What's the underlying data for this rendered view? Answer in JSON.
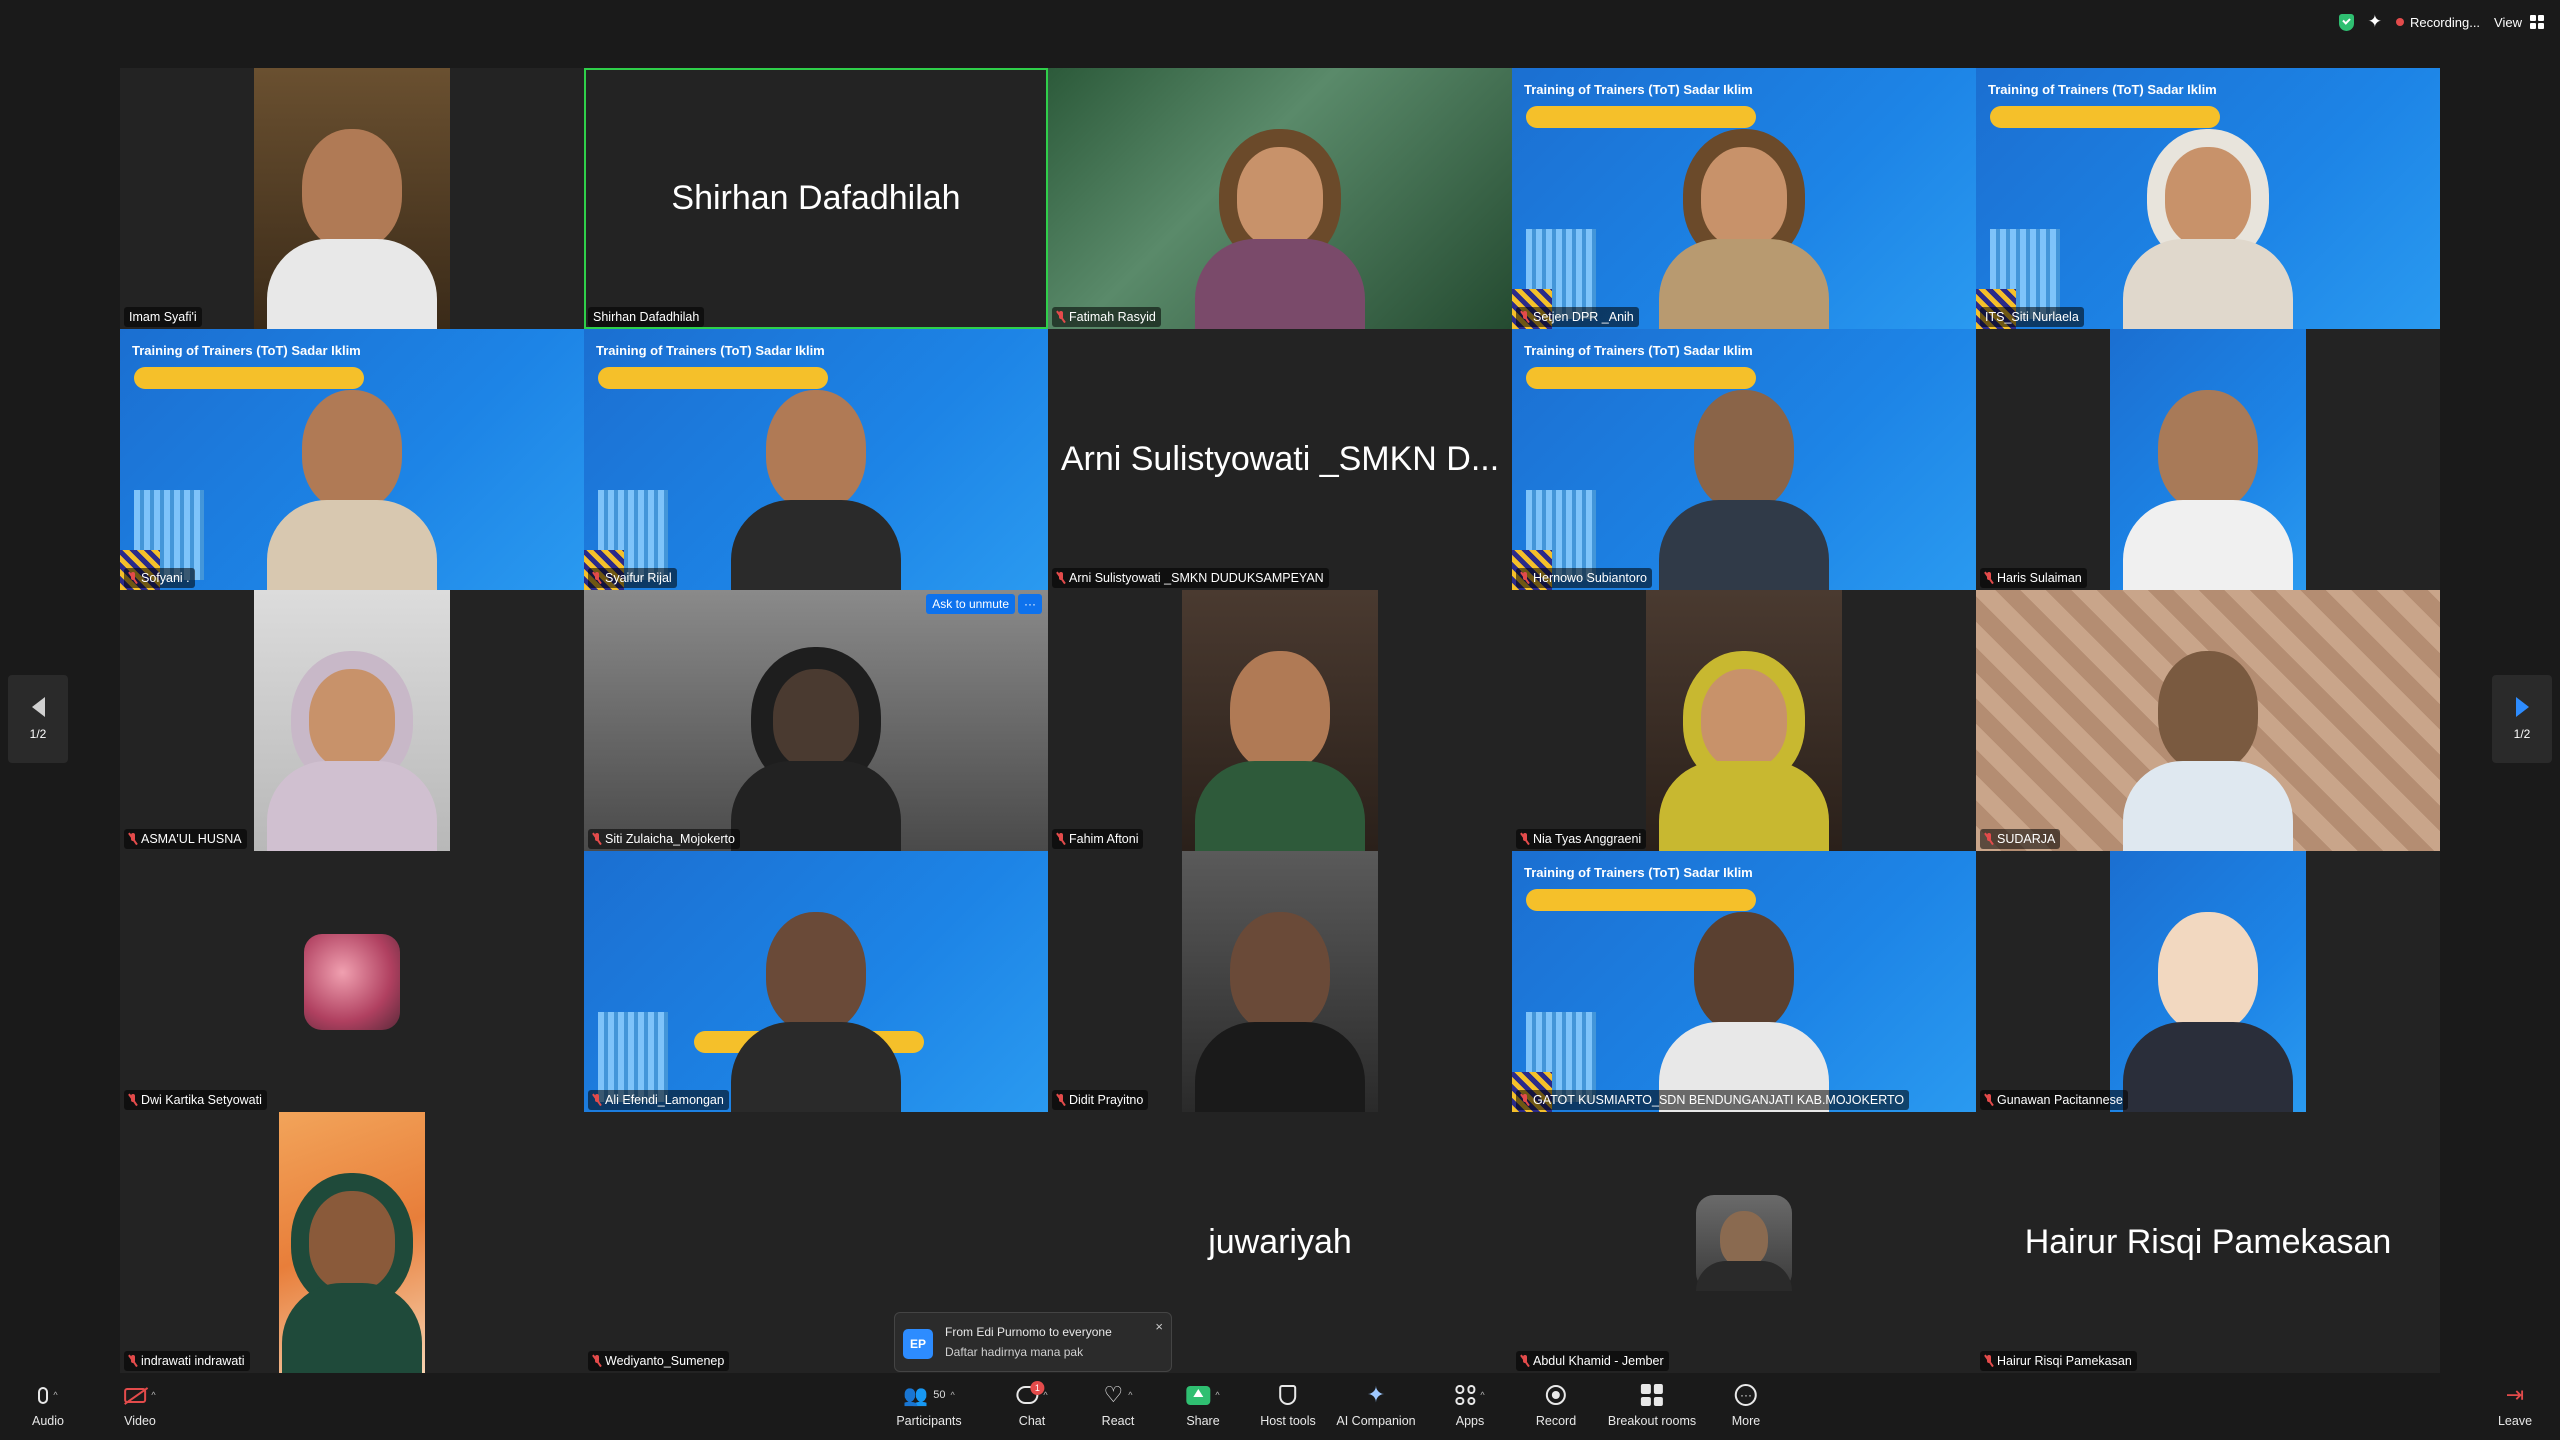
{
  "topbar": {
    "recording_label": "Recording...",
    "view_label": "View"
  },
  "pager": {
    "left_label": "1/2",
    "right_label": "1/2"
  },
  "tiles": [
    {
      "name": "Imam Syafi'i",
      "muted": false
    },
    {
      "name": "Shirhan Dafadhilah",
      "muted": false,
      "display_name": "Shirhan Dafadhilah",
      "active": true
    },
    {
      "name": "Fatimah Rasyid",
      "muted": true
    },
    {
      "name": "Setjen DPR _Anih",
      "muted": true
    },
    {
      "name": "ITS_Siti Nurlaela",
      "muted": false
    },
    {
      "name": "Sofyani .",
      "muted": true
    },
    {
      "name": "Syaifur Rijal",
      "muted": true
    },
    {
      "name": "Arni Sulistyowati _SMKN DUDUKSAMPEYAN",
      "muted": true,
      "display_name": "Arni Sulistyowati _SMKN D..."
    },
    {
      "name": "Hernowo Subiantoro",
      "muted": true
    },
    {
      "name": "Haris Sulaiman",
      "muted": true
    },
    {
      "name": "ASMA'UL HUSNA",
      "muted": true
    },
    {
      "name": "Siti Zulaicha_Mojokerto",
      "muted": true
    },
    {
      "name": "Fahim Aftoni",
      "muted": true
    },
    {
      "name": "Nia Tyas Anggraeni",
      "muted": true
    },
    {
      "name": "SUDARJA",
      "muted": true
    },
    {
      "name": "Dwi Kartika Setyowati",
      "muted": true
    },
    {
      "name": "Ali Efendi_Lamongan",
      "muted": true
    },
    {
      "name": "Didit Prayitno",
      "muted": true
    },
    {
      "name": "GATOT KUSMIARTO_SDN BENDUNGANJATI KAB.MOJOKERTO",
      "muted": true
    },
    {
      "name": "Gunawan Pacitannese",
      "muted": true
    },
    {
      "name": "indrawati indrawati",
      "muted": true
    },
    {
      "name": "Wediyanto_Sumenep",
      "muted": true
    },
    {
      "name": "juwariyah",
      "muted": false,
      "display_name": "juwariyah"
    },
    {
      "name": "Abdul Khamid - Jember",
      "muted": true
    },
    {
      "name": "Hairur Risqi Pamekasan",
      "muted": true,
      "display_name": "Hairur Risqi Pamekasan"
    }
  ],
  "slide": {
    "title": "Training of Trainers (ToT) Sadar Iklim"
  },
  "ask_to_unmute": {
    "label": "Ask to unmute",
    "more": "···"
  },
  "chat_toast": {
    "avatar": "EP",
    "from": "From Edi Purnomo to everyone",
    "message": "Daftar hadirnya mana pak",
    "close": "×"
  },
  "toolbar": {
    "audio": "Audio",
    "video": "Video",
    "participants": "Participants",
    "participants_count": "50",
    "chat": "Chat",
    "chat_badge": "1",
    "react": "React",
    "share": "Share",
    "host_tools": "Host tools",
    "ai_companion": "AI Companion",
    "apps": "Apps",
    "record": "Record",
    "breakout_rooms": "Breakout rooms",
    "more": "More",
    "leave": "Leave"
  },
  "colors": {
    "accent": "#2d8cff",
    "muted_red": "#e34b4b",
    "active_green": "#2fcf4a",
    "share_green": "#2fbf71"
  }
}
